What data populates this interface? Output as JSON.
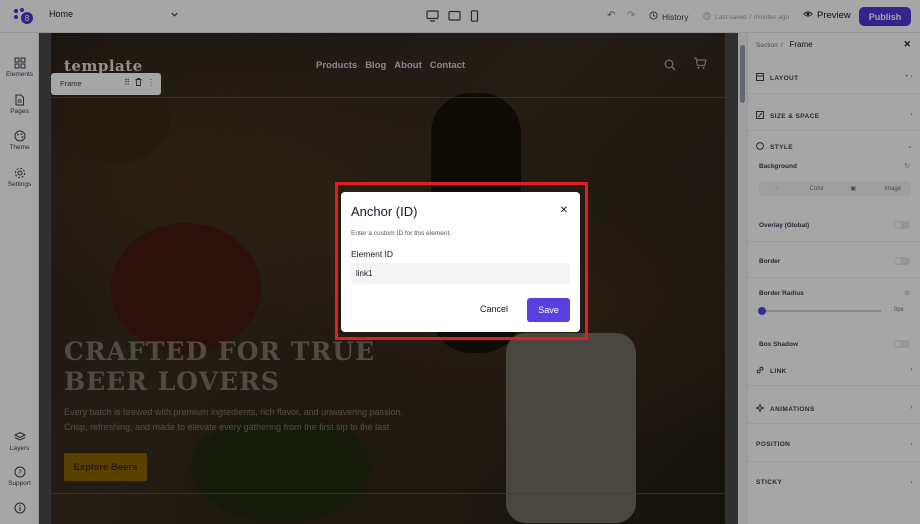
{
  "topbar": {
    "page_name": "Home",
    "history_label": "History",
    "last_saved": "Last saved 7 minutes ago",
    "preview_label": "Preview",
    "publish_label": "Publish",
    "accent_color": "#4f36d6"
  },
  "leftbar": {
    "items": [
      {
        "label": "Elements",
        "icon": "grid-icon"
      },
      {
        "label": "Pages",
        "icon": "page-icon"
      },
      {
        "label": "Theme",
        "icon": "palette-icon"
      },
      {
        "label": "Settings",
        "icon": "gear-icon"
      },
      {
        "label": "Layers",
        "icon": "layers-icon"
      },
      {
        "label": "Support",
        "icon": "help-icon"
      }
    ]
  },
  "canvas": {
    "logo": "template",
    "nav": [
      "Products",
      "Blog",
      "About",
      "Contact"
    ],
    "frame_tag": "Frame",
    "hero_title_line1": "CRAFTED FOR TRUE",
    "hero_title_line2": "BEER LOVERS",
    "hero_text": "Every batch is brewed with premium ingredients, rich flavor, and unwavering passion. Crisp, refreshing, and made to elevate every gathering from the first sip to the last.",
    "cta_label": "Explore Beers"
  },
  "right_panel": {
    "breadcrumb_parent": "Section",
    "breadcrumb_current": "Frame",
    "sections": {
      "layout": "LAYOUT",
      "size_space": "SIZE & SPACE",
      "style": "STYLE",
      "link": "LINK",
      "animations": "ANIMATIONS",
      "position": "POSITION",
      "sticky": "STICKY"
    },
    "background_label": "Background",
    "bg_options": [
      "Color",
      "Image"
    ],
    "overlay_label": "Overlay (Global)",
    "border_label": "Border",
    "border_radius_label": "Border Radius",
    "border_radius_value": "0px",
    "box_shadow_label": "Box Shadow"
  },
  "modal": {
    "title": "Anchor (ID)",
    "description": "Enter a custom ID for this element.",
    "field_label": "Element ID",
    "field_value": "link1",
    "cancel_label": "Cancel",
    "save_label": "Save",
    "save_color": "#5b3ee0",
    "highlight_color": "#e11d25"
  }
}
